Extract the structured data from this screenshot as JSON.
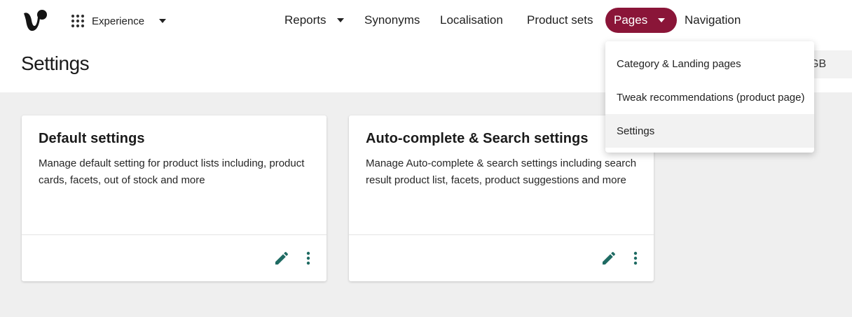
{
  "app": {
    "switcher_label": "Experience",
    "brand_color": "#8a1538",
    "accent_color": "#1f6b63"
  },
  "nav": {
    "items": [
      {
        "label": "Reports",
        "has_caret": true
      },
      {
        "label": "Synonyms"
      },
      {
        "label": "Localisation"
      },
      {
        "label": "Product sets"
      },
      {
        "label": "Pages",
        "has_caret": true,
        "active": true
      },
      {
        "label": "Navigation"
      }
    ]
  },
  "page": {
    "title": "Settings",
    "region_label": "GB"
  },
  "dropdown": {
    "items": [
      {
        "label": "Category & Landing pages"
      },
      {
        "label": "Tweak recommendations (product page)"
      },
      {
        "label": "Settings",
        "selected": true
      }
    ]
  },
  "cards": [
    {
      "title": "Default settings",
      "description": "Manage default setting for product lists including, product cards, facets, out of stock and more",
      "icons": [
        "pencil-icon",
        "more-vertical-icon"
      ]
    },
    {
      "title": "Auto-complete & Search settings",
      "description": "Manage Auto-complete & search settings including search result product list, facets, product suggestions and more",
      "icons": [
        "pencil-icon",
        "more-vertical-icon"
      ]
    }
  ]
}
